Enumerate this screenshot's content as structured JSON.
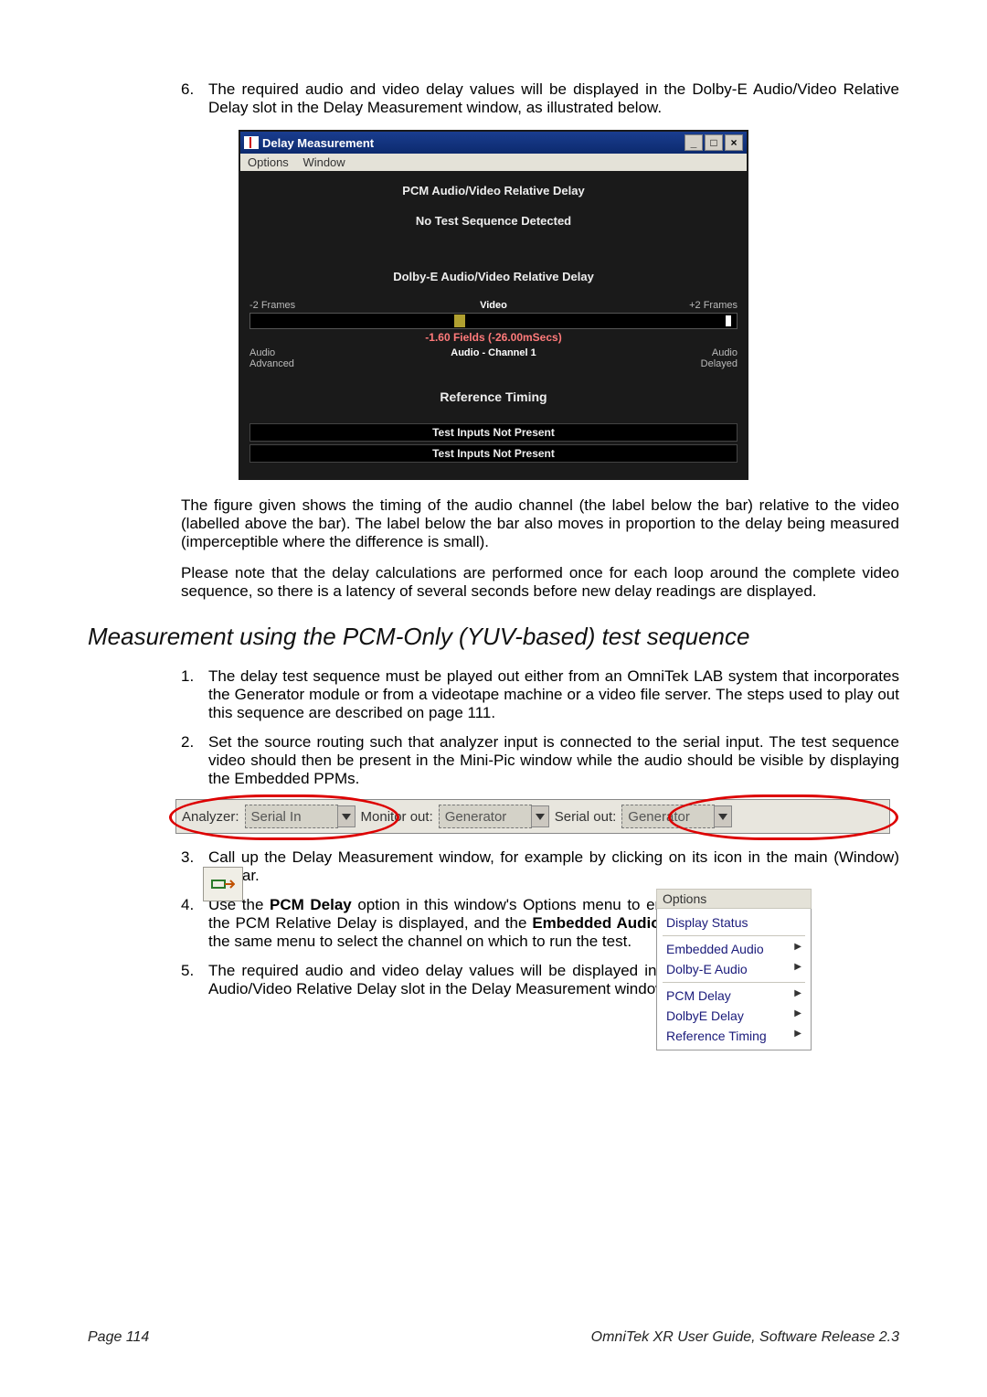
{
  "step6": {
    "num": "6.",
    "text": "The required audio and video delay values will be displayed in the Dolby-E Audio/Video Relative Delay slot in the Delay Measurement window, as illustrated below."
  },
  "dm": {
    "title": "Delay Measurement",
    "menu_options": "Options",
    "menu_window": "Window",
    "pcm_heading": "PCM Audio/Video Relative Delay",
    "no_seq": "No Test Sequence Detected",
    "dolby_heading": "Dolby-E Audio/Video Relative Delay",
    "left_frames": "-2 Frames",
    "right_frames": "+2 Frames",
    "video_lbl": "Video",
    "value": "-1.60 Fields (-26.00mSecs)",
    "audio_adv": "Audio Advanced",
    "audio_ch": "Audio - Channel 1",
    "audio_delayed": "Audio Delayed",
    "ref_timing": "Reference Timing",
    "not_present": "Test Inputs Not Present"
  },
  "para1": "The figure given shows the timing of the audio channel (the label below the bar) relative to the video (labelled above the bar). The label below the bar also moves in proportion to the delay being measured (imperceptible where the difference is small).",
  "para2": "Please note that the delay calculations are performed once for each loop around the complete video sequence, so there is a latency of several seconds before new delay readings are displayed.",
  "section_heading": "Measurement using the PCM-Only (YUV-based) test sequence",
  "seq_step1": {
    "num": "1.",
    "text": "The delay test sequence must be played out either from an OmniTek LAB system that incorporates the Generator module or from a videotape machine or a video file server. The steps used to play out this sequence are described on page 111."
  },
  "seq_step2": {
    "num": "2.",
    "text": "Set the source routing such that analyzer input is connected to the serial input. The test sequence video should then be present in the Mini-Pic window while the audio should be visible by displaying the Embedded PPMs."
  },
  "route": {
    "analyzer": "Analyzer:",
    "serial_in": "Serial In",
    "monitor_out": "Monitor out:",
    "generator": "Generator",
    "serial_out": "Serial out:",
    "generator2": "Generator"
  },
  "seq_step3": {
    "num": "3.",
    "text": "Call up the Delay Measurement window, for example by clicking on its icon in the main (Window) toolbar."
  },
  "seq_step4": {
    "num": "4.",
    "pre": "Use the ",
    "b1": "PCM Delay",
    "mid": " option in this window's Options menu to ensure that the PCM Relative Delay is displayed, and the ",
    "b2": "Embedded Audio",
    "post": " option in the same menu to select the channel on which to run the test."
  },
  "seq_step5": {
    "num": "5.",
    "text": "The required audio and video delay values will be displayed in the PCM Audio/Video Relative Delay slot in the Delay Measurement window."
  },
  "opts": {
    "hdr": "Options",
    "display_status": "Display Status",
    "embedded_audio": "Embedded Audio",
    "dolby_e_audio": "Dolby-E Audio",
    "pcm_delay": "PCM Delay",
    "dolbye_delay": "DolbyE Delay",
    "ref_timing": "Reference Timing"
  },
  "footer": {
    "left": "Page 114",
    "right": "OmniTek XR User Guide, Software Release 2.3"
  }
}
